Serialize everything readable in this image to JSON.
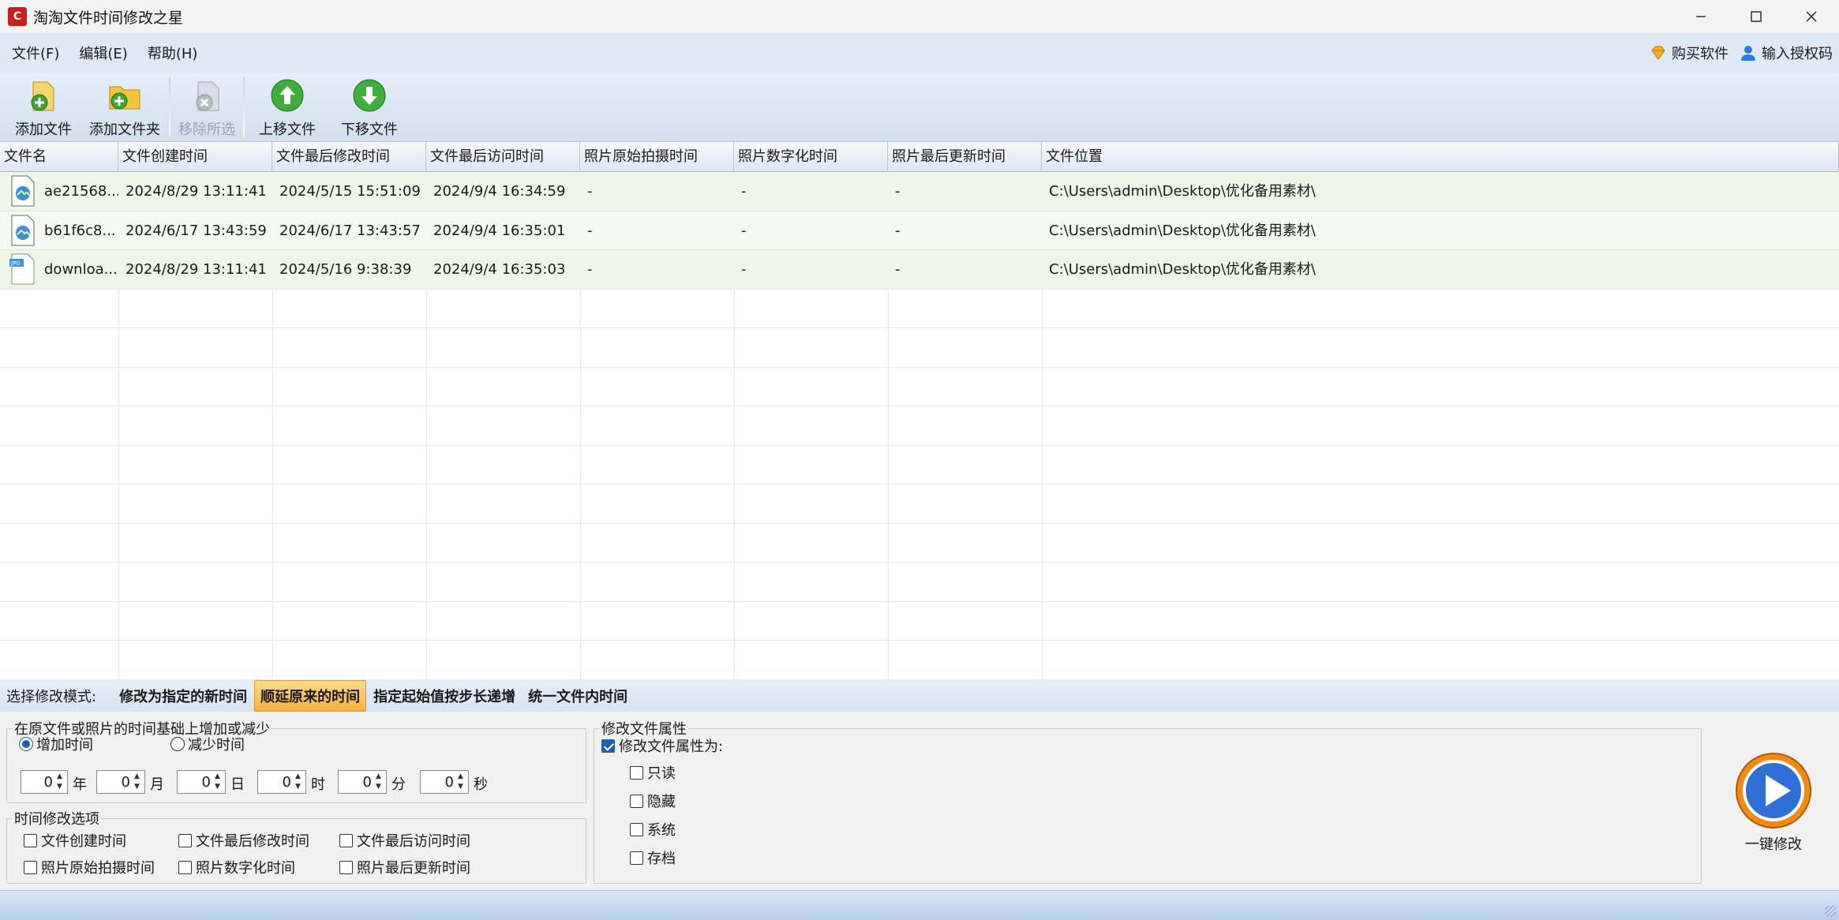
{
  "window": {
    "title": "淘淘文件时间修改之星",
    "app_icon_glyph": "C"
  },
  "menu": {
    "items": [
      "文件(F)",
      "编辑(E)",
      "帮助(H)"
    ],
    "buy_label": "购买软件",
    "license_label": "输入授权码"
  },
  "toolbar": {
    "add_file": "添加文件",
    "add_folder": "添加文件夹",
    "remove_selected": "移除所选",
    "move_up": "上移文件",
    "move_down": "下移文件"
  },
  "table": {
    "columns": [
      "文件名",
      "文件创建时间",
      "文件最后修改时间",
      "文件最后访问时间",
      "照片原始拍摄时间",
      "照片数字化时间",
      "照片最后更新时间",
      "文件位置"
    ],
    "rows": [
      {
        "icon": "image-file-icon",
        "name": "ae21568...",
        "created": "2024/8/29 13:11:41",
        "modified": "2024/5/15 15:51:09",
        "accessed": "2024/9/4 16:34:59",
        "photo_taken": "-",
        "digitized": "-",
        "photo_updated": "-",
        "location": "C:\\Users\\admin\\Desktop\\优化备用素材\\"
      },
      {
        "icon": "image-file-icon",
        "name": "b61f6c8...",
        "created": "2024/6/17 13:43:59",
        "modified": "2024/6/17 13:43:57",
        "accessed": "2024/9/4 16:35:01",
        "photo_taken": "-",
        "digitized": "-",
        "photo_updated": "-",
        "location": "C:\\Users\\admin\\Desktop\\优化备用素材\\"
      },
      {
        "icon": "jpg-file-icon",
        "name": "downloa...",
        "created": "2024/8/29 13:11:41",
        "modified": "2024/5/16 9:38:39",
        "accessed": "2024/9/4 16:35:03",
        "photo_taken": "-",
        "digitized": "-",
        "photo_updated": "-",
        "location": "C:\\Users\\admin\\Desktop\\优化备用素材\\"
      }
    ]
  },
  "mode": {
    "label": "选择修改模式:",
    "tabs": [
      "修改为指定的新时间",
      "顺延原来的时间",
      "指定起始值按步长递增",
      "统一文件内时间"
    ],
    "active_index": 1
  },
  "shift_group": {
    "title": "在原文件或照片的时间基础上增加或减少",
    "increase_label": "增加时间",
    "decrease_label": "减少时间",
    "selected": "increase",
    "fields": [
      {
        "value": "0",
        "unit": "年"
      },
      {
        "value": "0",
        "unit": "月"
      },
      {
        "value": "0",
        "unit": "日"
      },
      {
        "value": "0",
        "unit": "时"
      },
      {
        "value": "0",
        "unit": "分"
      },
      {
        "value": "0",
        "unit": "秒"
      }
    ]
  },
  "options_group": {
    "title": "时间修改选项",
    "items": [
      {
        "label": "文件创建时间",
        "checked": false
      },
      {
        "label": "文件最后修改时间",
        "checked": false
      },
      {
        "label": "文件最后访问时间",
        "checked": false
      },
      {
        "label": "照片原始拍摄时间",
        "checked": false
      },
      {
        "label": "照片数字化时间",
        "checked": false
      },
      {
        "label": "照片最后更新时间",
        "checked": false
      }
    ]
  },
  "attr_group": {
    "title": "修改文件属性",
    "master": {
      "label": "修改文件属性为:",
      "checked": true
    },
    "items": [
      {
        "label": "只读",
        "checked": false
      },
      {
        "label": "隐藏",
        "checked": false
      },
      {
        "label": "系统",
        "checked": false
      },
      {
        "label": "存档",
        "checked": false
      }
    ]
  },
  "apply": {
    "label": "一键修改"
  },
  "colors": {
    "accent": "#1a5fb4",
    "row_fill": "#eef6e8",
    "active_tab": "#f5b041",
    "toolbar": "#dbe6f4"
  }
}
